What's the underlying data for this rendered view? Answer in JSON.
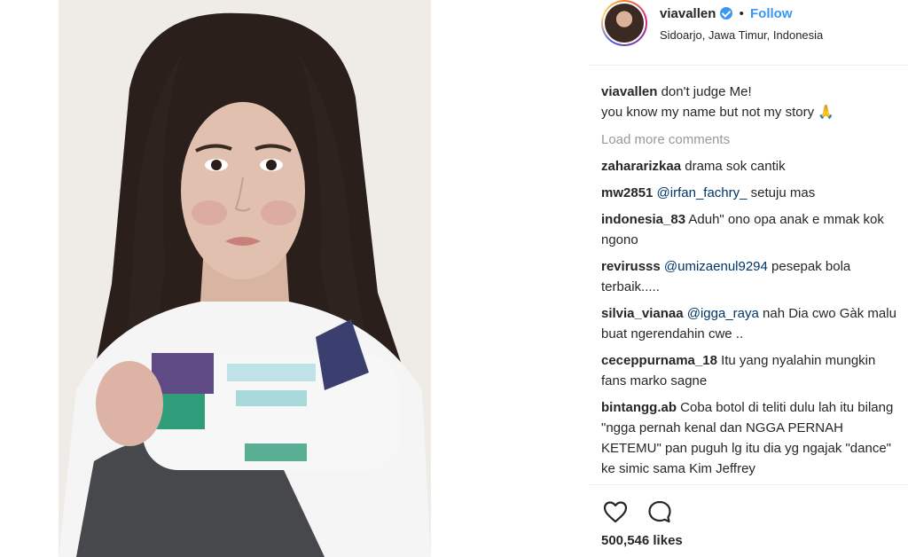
{
  "post": {
    "username": "viavallen",
    "separator": "•",
    "follow_label": "Follow",
    "location": "Sidoarjo, Jawa Timur, Indonesia",
    "verified_icon": "verified-badge-icon",
    "accent_color": "#3897f0"
  },
  "caption": {
    "user": "viavallen",
    "line1": "don't judge Me!",
    "line2": "you know my name but not my story",
    "emoji": "🙏"
  },
  "load_more_label": "Load more comments",
  "comments": [
    {
      "user": "zahararizkaa",
      "text": "drama sok cantik"
    },
    {
      "user": "mw2851",
      "mention": "@irfan_fachry_",
      "text": "setuju mas"
    },
    {
      "user": "indonesia_83",
      "text": "Aduh\" ono opa anak e mmak kok ngono"
    },
    {
      "user": "revirusss",
      "mention": "@umizaenul9294",
      "text": "pesepak bola terbaik....."
    },
    {
      "user": "silvia_vianaa",
      "mention": "@igga_raya",
      "text": "nah Dia cwo Gàk malu buat ngerendahin cwe .."
    },
    {
      "user": "ceceppurnama_18",
      "text": "Itu yang nyalahin mungkin fans marko sagne"
    },
    {
      "user": "bintangg.ab",
      "text": "Coba botol di teliti dulu lah itu bilang \"ngga pernah kenal dan NGGA PERNAH KETEMU\" pan puguh lg itu dia yg ngajak \"dance\" ke simic sama Kim Jeffrey"
    }
  ],
  "actions": {
    "like_icon": "heart-icon",
    "comment_icon": "comment-icon"
  },
  "likes": "500,546 likes"
}
